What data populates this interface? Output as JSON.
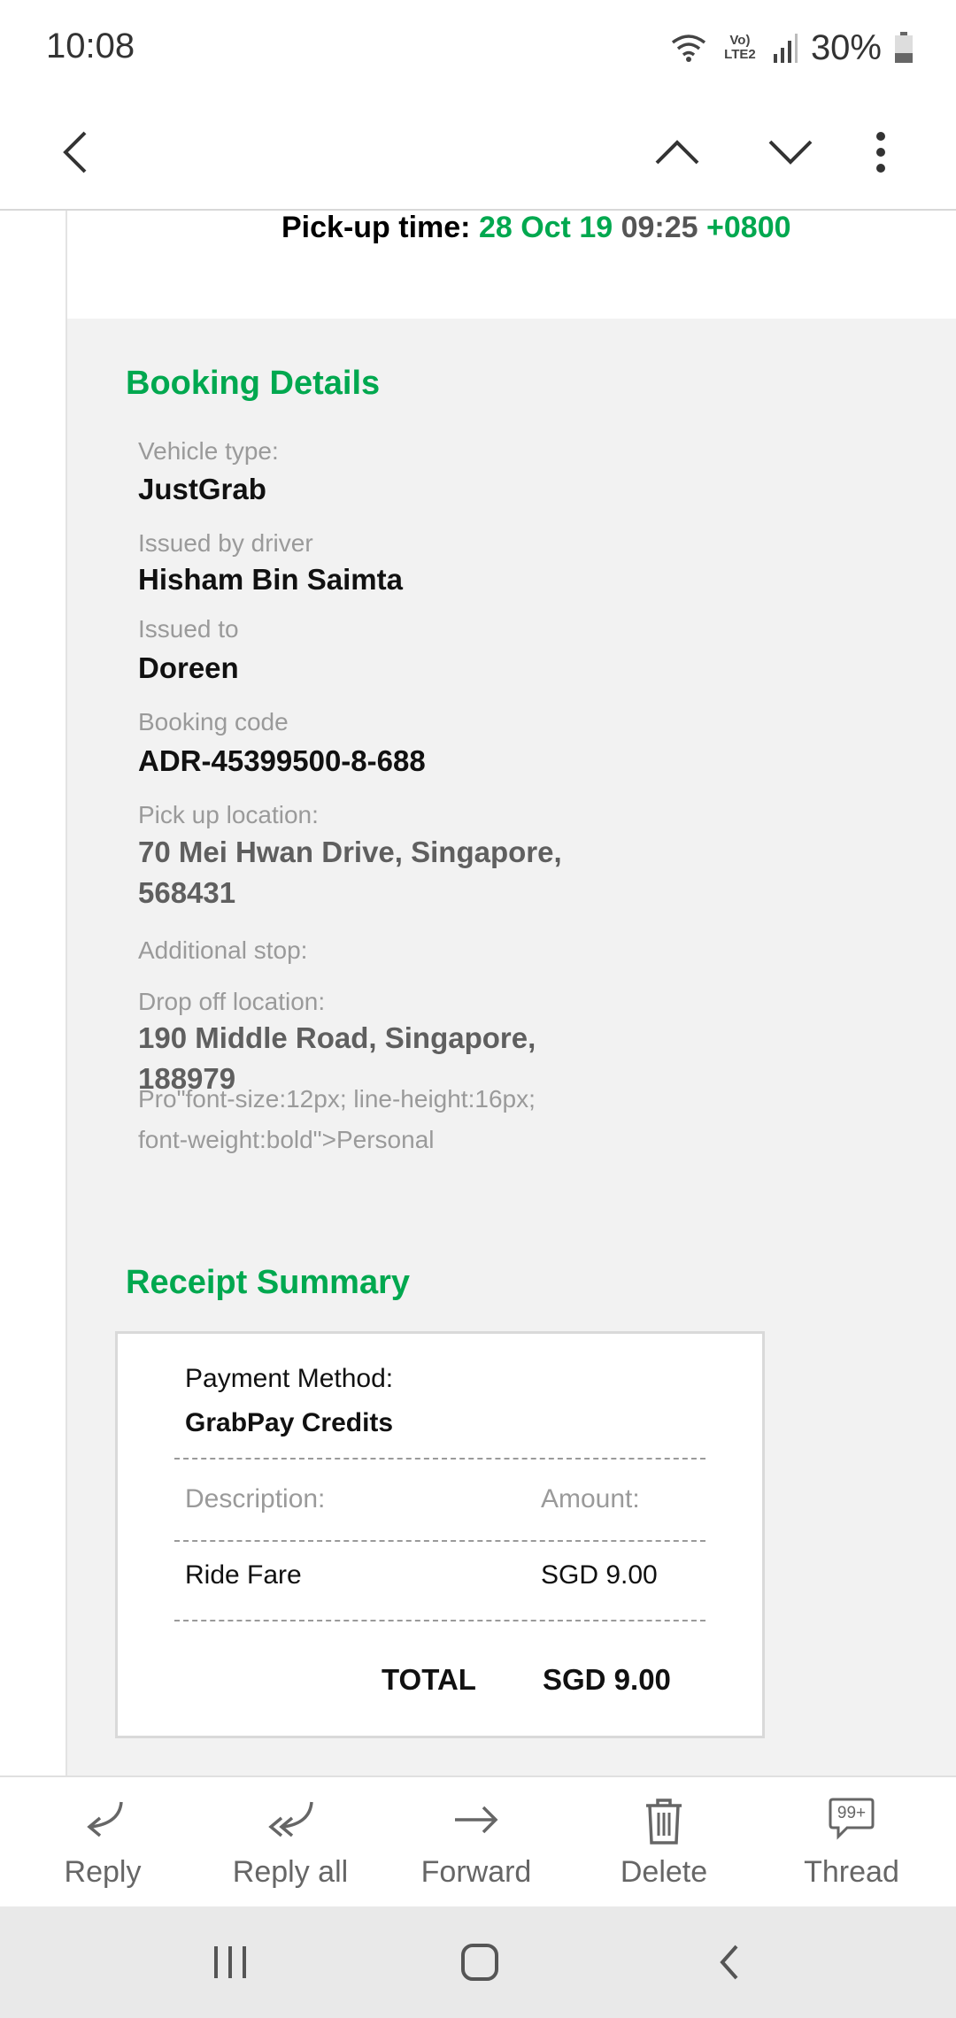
{
  "status": {
    "time": "10:08",
    "network": "Vo) LTE2",
    "battery": "30%"
  },
  "pickup": {
    "label": "Pick-up time:",
    "date": "28 Oct 19",
    "time": "09:25",
    "tz": "+0800"
  },
  "booking": {
    "title": "Booking Details",
    "vehicle_label": "Vehicle type:",
    "vehicle": "JustGrab",
    "driver_label": "Issued by driver",
    "driver": "Hisham Bin Saimta",
    "issued_to_label": "Issued to",
    "issued_to": "Doreen",
    "code_label": "Booking code",
    "code": "ADR-45399500-8-688",
    "pickup_label": "Pick up location:",
    "pickup_line1": "70 Mei Hwan Drive, Singapore,",
    "pickup_line2": "568431",
    "stop_label": "Additional stop:",
    "dropoff_label": "Drop off location:",
    "dropoff_line1": "190 Middle Road, Singapore,",
    "dropoff_line2": "188979",
    "note_line1": "Pro\"font-size:12px; line-height:16px;",
    "note_line2": "font-weight:bold\">Personal"
  },
  "receipt": {
    "title": "Receipt Summary",
    "payment_label": "Payment Method:",
    "payment_value": "GrabPay Credits",
    "desc_header": "Description:",
    "amount_header": "Amount:",
    "item": "Ride Fare",
    "item_amount": "SGD 9.00",
    "total_label": "TOTAL",
    "total_value": "SGD 9.00"
  },
  "actions": {
    "reply": "Reply",
    "reply_all": "Reply all",
    "forward": "Forward",
    "delete": "Delete",
    "thread": "Thread",
    "thread_badge": "99+"
  },
  "colors": {
    "accent_green": "#00a84f",
    "panel_bg": "#f2f2f2"
  }
}
